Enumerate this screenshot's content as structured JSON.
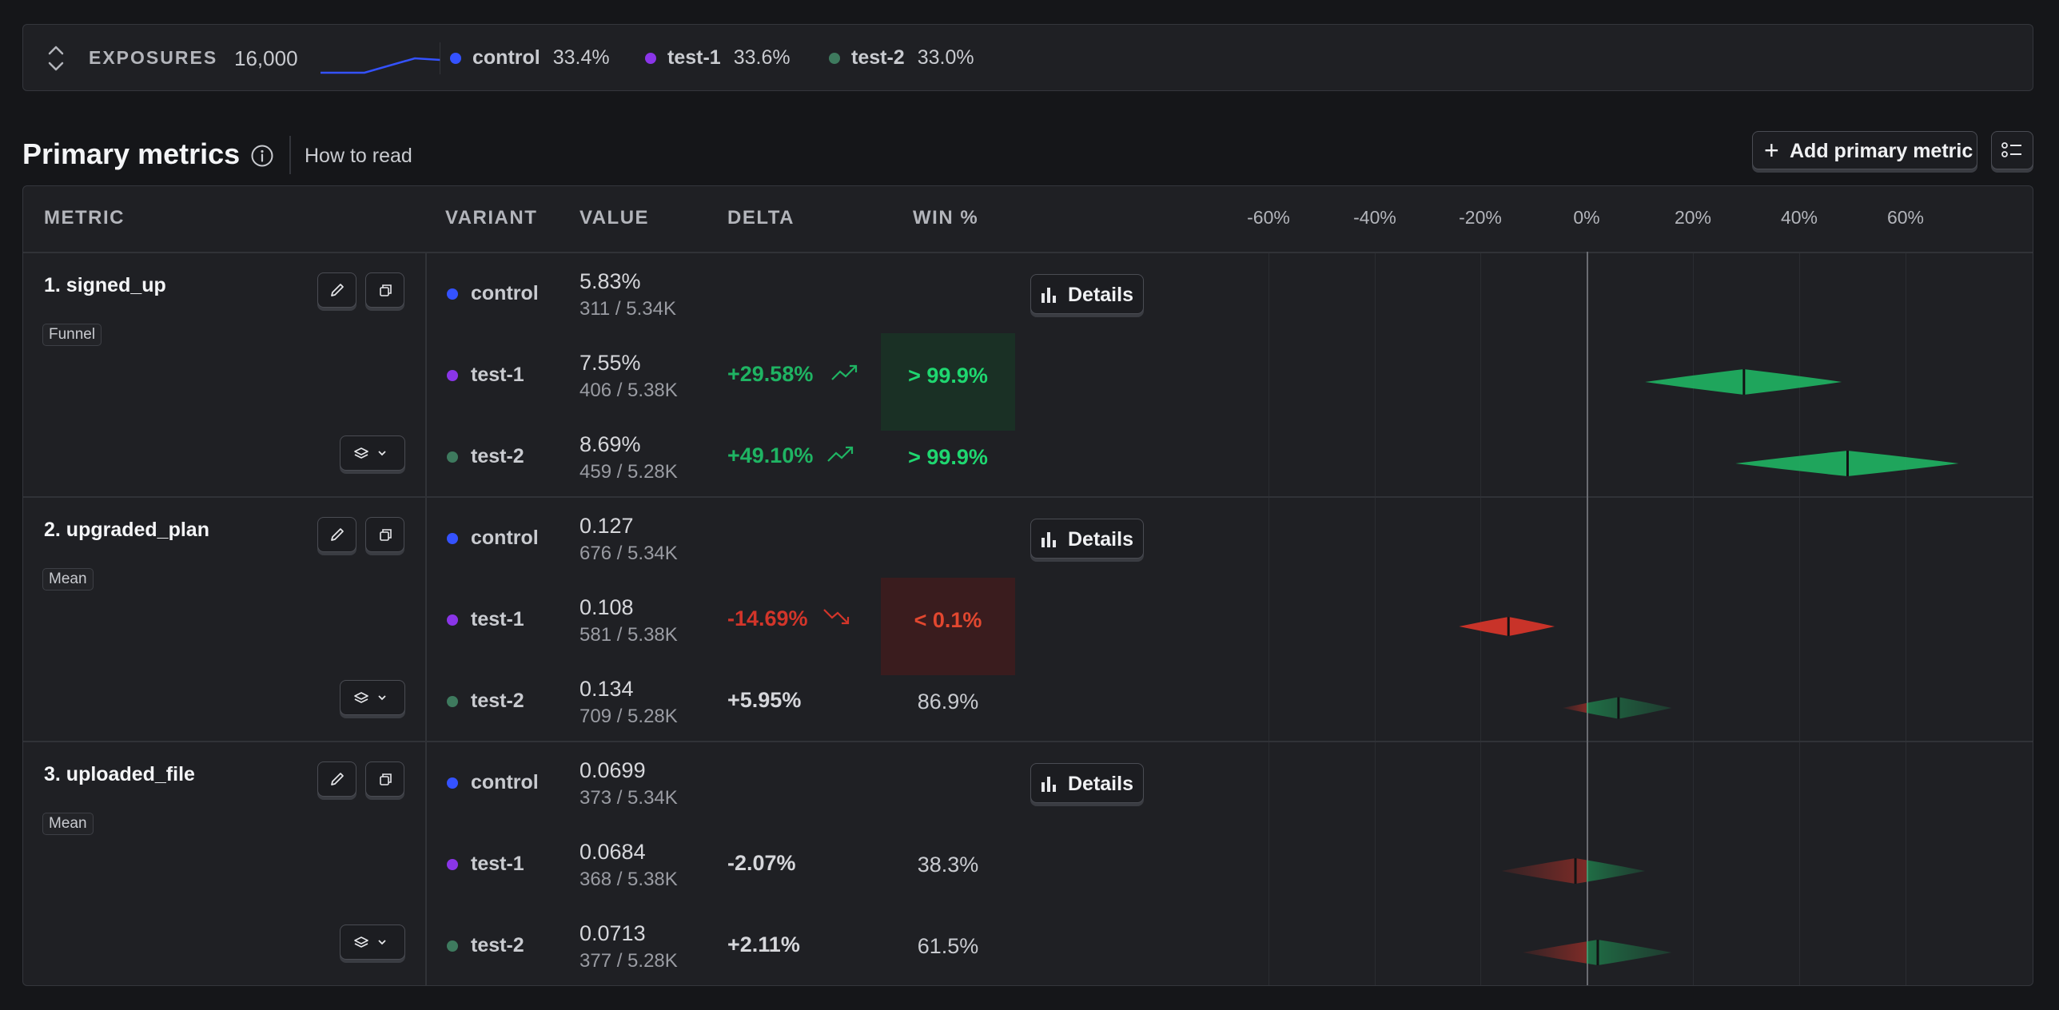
{
  "exposures": {
    "label": "EXPOSURES",
    "count": "16,000",
    "variants": [
      {
        "name": "control",
        "pct": "33.4%",
        "color": "#3452ff"
      },
      {
        "name": "test-1",
        "pct": "33.6%",
        "color": "#8a35e8"
      },
      {
        "name": "test-2",
        "pct": "33.0%",
        "color": "#3e7a5e"
      }
    ]
  },
  "header": {
    "title": "Primary metrics",
    "how_to_read": "How to read",
    "add_button": "Add primary metric"
  },
  "columns": {
    "metric": "METRIC",
    "variant": "VARIANT",
    "value": "VALUE",
    "delta": "DELTA",
    "win": "WIN %",
    "ticks": [
      "-60%",
      "-40%",
      "-20%",
      "0%",
      "20%",
      "40%",
      "60%"
    ]
  },
  "details_label": "Details",
  "metrics": [
    {
      "name": "1. signed_up",
      "type": "Funnel",
      "rows": [
        {
          "variant": "control",
          "value": "5.83%",
          "sub": "311 / 5.34K",
          "delta": "",
          "win": ""
        },
        {
          "variant": "test-1",
          "value": "7.55%",
          "sub": "406 / 5.38K",
          "delta": "+29.58%",
          "win": "> 99.9%"
        },
        {
          "variant": "test-2",
          "value": "8.69%",
          "sub": "459 / 5.28K",
          "delta": "+49.10%",
          "win": "> 99.9%"
        }
      ]
    },
    {
      "name": "2. upgraded_plan",
      "type": "Mean",
      "rows": [
        {
          "variant": "control",
          "value": "0.127",
          "sub": "676 / 5.34K",
          "delta": "",
          "win": ""
        },
        {
          "variant": "test-1",
          "value": "0.108",
          "sub": "581 / 5.38K",
          "delta": "-14.69%",
          "win": "< 0.1%"
        },
        {
          "variant": "test-2",
          "value": "0.134",
          "sub": "709 / 5.28K",
          "delta": "+5.95%",
          "win": "86.9%"
        }
      ]
    },
    {
      "name": "3. uploaded_file",
      "type": "Mean",
      "rows": [
        {
          "variant": "control",
          "value": "0.0699",
          "sub": "373 / 5.34K",
          "delta": "",
          "win": ""
        },
        {
          "variant": "test-1",
          "value": "0.0684",
          "sub": "368 / 5.38K",
          "delta": "-2.07%",
          "win": "38.3%"
        },
        {
          "variant": "test-2",
          "value": "0.0713",
          "sub": "377 / 5.28K",
          "delta": "+2.11%",
          "win": "61.5%"
        }
      ]
    }
  ],
  "colors": {
    "positive": "#1fb463",
    "negative": "#d2352a",
    "positive_bg": "#1a3025",
    "negative_bg": "#3a1c1e"
  },
  "chart_data": {
    "type": "violin-intervals",
    "x_unit": "% delta vs control",
    "xlim": [
      -75,
      80
    ],
    "ticks": [
      -60,
      -40,
      -20,
      0,
      20,
      40,
      60
    ],
    "intervals": [
      {
        "metric": "1. signed_up",
        "variant": "test-1",
        "low": 11,
        "mid": 29.6,
        "high": 48,
        "style": "positive"
      },
      {
        "metric": "1. signed_up",
        "variant": "test-2",
        "low": 28,
        "mid": 49.1,
        "high": 70,
        "style": "positive"
      },
      {
        "metric": "2. upgraded_plan",
        "variant": "test-1",
        "low": -24,
        "mid": -14.7,
        "high": -6,
        "style": "negative"
      },
      {
        "metric": "2. upgraded_plan",
        "variant": "test-2",
        "low": -4.5,
        "mid": 6,
        "high": 16,
        "style": "mixed"
      },
      {
        "metric": "3. uploaded_file",
        "variant": "test-1",
        "low": -16,
        "mid": -2.1,
        "high": 11,
        "style": "mixed"
      },
      {
        "metric": "3. uploaded_file",
        "variant": "test-2",
        "low": -12,
        "mid": 2.1,
        "high": 16,
        "style": "mixed"
      }
    ]
  }
}
